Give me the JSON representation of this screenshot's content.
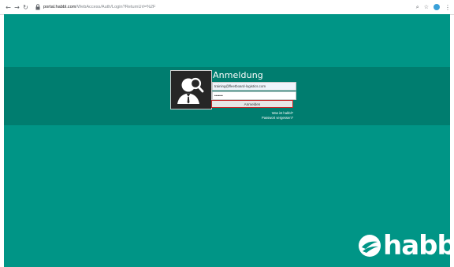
{
  "browser": {
    "back_icon": "arrow-left-icon",
    "forward_icon": "arrow-right-icon",
    "reload_icon": "reload-icon",
    "url_host": "portal.habbl.com",
    "url_path": "/WebAccess/Auth/Login?ReturnUrl=%2F",
    "zoom_icon": "magnifier-icon",
    "bookmark_icon": "star-icon",
    "menu_icon": "kebab-menu-icon"
  },
  "login": {
    "title": "Anmeldung",
    "username_value": "training@fleetboard-logistics.com",
    "password_value": "•••••••",
    "submit_label": "Anmelden",
    "what_is_link": "Was ist habbl?",
    "forgot_link": "Passwort vergessen?",
    "avatar_icon": "user-search-icon"
  },
  "brand": {
    "logo_text": "habbl",
    "background_color": "#009586",
    "band_color": "#007d6f",
    "highlight_color": "#c62828"
  }
}
